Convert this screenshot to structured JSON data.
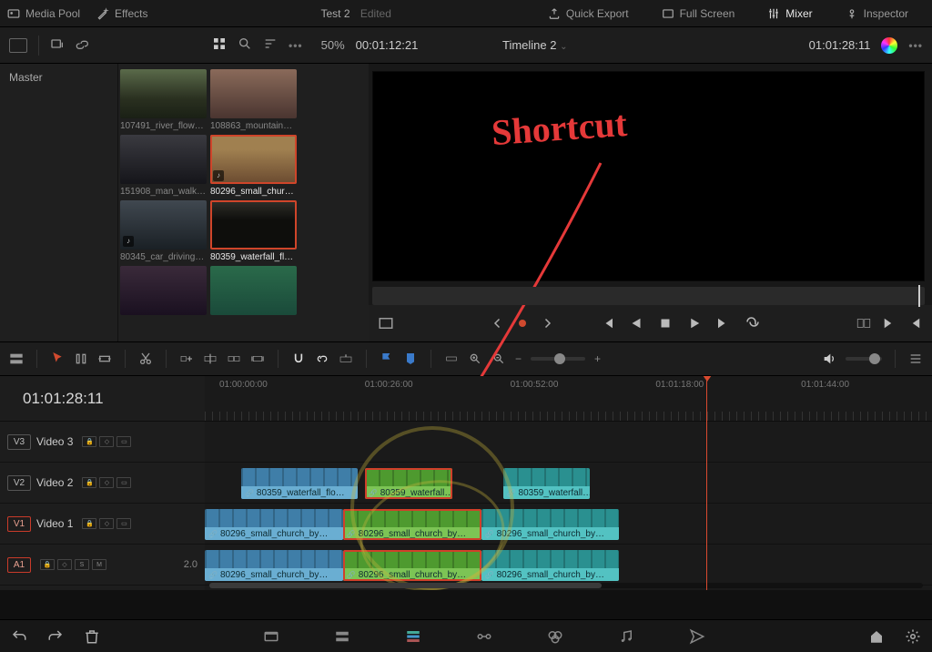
{
  "top": {
    "mediaPool": "Media Pool",
    "effects": "Effects",
    "projectName": "Test 2",
    "projectStatus": "Edited",
    "quickExport": "Quick Export",
    "fullScreen": "Full Screen",
    "mixer": "Mixer",
    "inspector": "Inspector"
  },
  "second": {
    "zoom": "50%",
    "sourceTC": "00:01:12:21",
    "timelineName": "Timeline 2",
    "recordTC": "01:01:28:11"
  },
  "media": {
    "master": "Master",
    "clips": [
      {
        "label": "107491_river_flow…",
        "sel": false,
        "audio": false,
        "bg": "linear-gradient(#5a6a4a,#2a3020 60%,#1a2015)"
      },
      {
        "label": "108863_mountain…",
        "sel": false,
        "audio": false,
        "bg": "linear-gradient(#8a6a5a,#4a3530)"
      },
      {
        "label": "151908_man_walk…",
        "sel": false,
        "audio": false,
        "bg": "linear-gradient(#3a3a40,#15151a)"
      },
      {
        "label": "80296_small_chur…",
        "sel": true,
        "audio": true,
        "bg": "linear-gradient(#a08050 30%,#6a4a30)"
      },
      {
        "label": "80345_car_driving…",
        "sel": false,
        "audio": true,
        "bg": "linear-gradient(#404850,#1a2025)"
      },
      {
        "label": "80359_waterfall_fl…",
        "sel": true,
        "audio": false,
        "bg": "linear-gradient(#30302a,#0e0e0c 40%,#0e0e0c)"
      },
      {
        "label": "",
        "sel": false,
        "audio": false,
        "bg": "linear-gradient(#3a2a3a,#1a1020)"
      },
      {
        "label": "",
        "sel": false,
        "audio": false,
        "bg": "linear-gradient(180deg,#2a6a4a,#1a4a3a)"
      }
    ]
  },
  "timeline": {
    "currentTC": "01:01:28:11",
    "ruler": [
      "01:00:00:00",
      "01:00:26:00",
      "01:00:52:00",
      "01:01:18:00",
      "01:01:44:00"
    ],
    "playheadPct": 69,
    "tracks": [
      {
        "id": "V3",
        "label": "Video 3",
        "active": false
      },
      {
        "id": "V2",
        "label": "Video 2",
        "active": false
      },
      {
        "id": "V1",
        "label": "Video 1",
        "active": true
      },
      {
        "id": "A1",
        "label": "",
        "active": true,
        "level": "2.0"
      }
    ],
    "clips": {
      "v2": [
        {
          "l": 5,
          "w": 16,
          "c": "blue",
          "lbl": "80359_waterfall_flo…",
          "sel": false
        },
        {
          "l": 22,
          "w": 12,
          "c": "green",
          "lbl": "80359_waterfall…",
          "sel": true
        },
        {
          "l": 41,
          "w": 12,
          "c": "teal",
          "lbl": "80359_waterfall…",
          "sel": false
        }
      ],
      "v1": [
        {
          "l": 0,
          "w": 19,
          "c": "blue",
          "lbl": "80296_small_church_by…",
          "sel": false
        },
        {
          "l": 19,
          "w": 19,
          "c": "green",
          "lbl": "80296_small_church_by…",
          "sel": true
        },
        {
          "l": 38,
          "w": 19,
          "c": "teal",
          "lbl": "80296_small_church_by…",
          "sel": false
        }
      ],
      "a1": [
        {
          "l": 0,
          "w": 19,
          "c": "blue",
          "lbl": "80296_small_church_by…",
          "sel": false
        },
        {
          "l": 19,
          "w": 19,
          "c": "green",
          "lbl": "80296_small_church_by…",
          "sel": true
        },
        {
          "l": 38,
          "w": 19,
          "c": "teal",
          "lbl": "80296_small_church_by…",
          "sel": false
        }
      ]
    }
  },
  "annotation": "Shortcut"
}
